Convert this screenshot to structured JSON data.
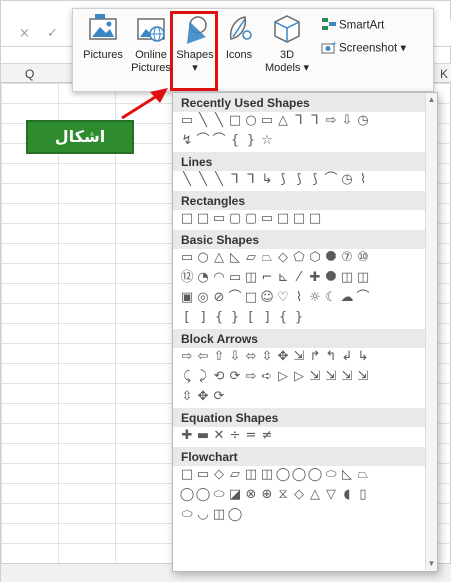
{
  "excel": {
    "column_headers": [
      "Q",
      "K"
    ],
    "formula_icons": [
      "×",
      "✓"
    ]
  },
  "ribbon": {
    "pictures_label": "Pictures",
    "online_pictures_label_1": "Online",
    "online_pictures_label_2": "Pictures",
    "shapes_label": "Shapes",
    "shapes_caret": "▾",
    "icons_label": "Icons",
    "models_label_1": "3D",
    "models_label_2": "Models ▾",
    "smartart_label": "SmartArt",
    "screenshot_label": "Screenshot ▾",
    "highlight_color": "#e01010"
  },
  "callout": {
    "text": "اشكال",
    "color": "#2e8b2e"
  },
  "dropdown": {
    "sections": [
      {
        "title": "Recently Used Shapes",
        "rows": [
          [
            "▭",
            "╲",
            "╲",
            "□",
            "○",
            "▭",
            "△",
            "⅂",
            "⅂",
            "⇨",
            "⇩",
            "◷"
          ],
          [
            "↯",
            "⌒",
            "⌒",
            "{",
            "}",
            "☆"
          ]
        ]
      },
      {
        "title": "Lines",
        "rows": [
          [
            "╲",
            "╲",
            "╲",
            "⅂",
            "⅂",
            "↳",
            "⟆",
            "⟆",
            "⟆",
            "⌒",
            "◷",
            "⌇"
          ]
        ]
      },
      {
        "title": "Rectangles",
        "rows": [
          [
            "□",
            "□",
            "▭",
            "▢",
            "▢",
            "▭",
            "□",
            "□",
            "□"
          ]
        ]
      },
      {
        "title": "Basic Shapes",
        "rows": [
          [
            "▭",
            "○",
            "△",
            "◺",
            "▱",
            "⏢",
            "◇",
            "⬠",
            "⬡",
            "⯃",
            "⑦",
            "⑩"
          ],
          [
            "⑫",
            "◔",
            "◠",
            "▭",
            "◫",
            "⌐",
            "⊾",
            "⁄",
            "✚",
            "⯃",
            "◫",
            "◫"
          ],
          [
            "▣",
            "◎",
            "⊘",
            "⌒",
            "□",
            "☺",
            "♡",
            "⌇",
            "☼",
            "☾",
            "☁",
            "⌒"
          ],
          [
            "[",
            "]",
            "{",
            "}",
            "[",
            "]",
            "{",
            "}"
          ]
        ]
      },
      {
        "title": "Block Arrows",
        "rows": [
          [
            "⇨",
            "⇦",
            "⇧",
            "⇩",
            "⬄",
            "⇳",
            "✥",
            "⇲",
            "↱",
            "↰",
            "↲",
            "↳"
          ],
          [
            "⤹",
            "⤸",
            "⟲",
            "⟳",
            "⇨",
            "➪",
            "▷",
            "▷",
            "⇲",
            "⇲",
            "⇲",
            "⇲"
          ],
          [
            "⇳",
            "✥",
            "⟳"
          ]
        ]
      },
      {
        "title": "Equation Shapes",
        "rows": [
          [
            "✚",
            "▬",
            "✕",
            "÷",
            "=",
            "≠"
          ]
        ]
      },
      {
        "title": "Flowchart",
        "rows": [
          [
            "□",
            "▭",
            "◇",
            "▱",
            "◫",
            "◫",
            "◯",
            "◯",
            "◯",
            "⬭",
            "◺",
            "⏢"
          ],
          [
            "◯",
            "◯",
            "⬭",
            "◪",
            "⊗",
            "⊕",
            "⧖",
            "◇",
            "△",
            "▽",
            "◖",
            "▯"
          ],
          [
            "⬭",
            "◡",
            "◫",
            "◯"
          ]
        ]
      }
    ]
  }
}
